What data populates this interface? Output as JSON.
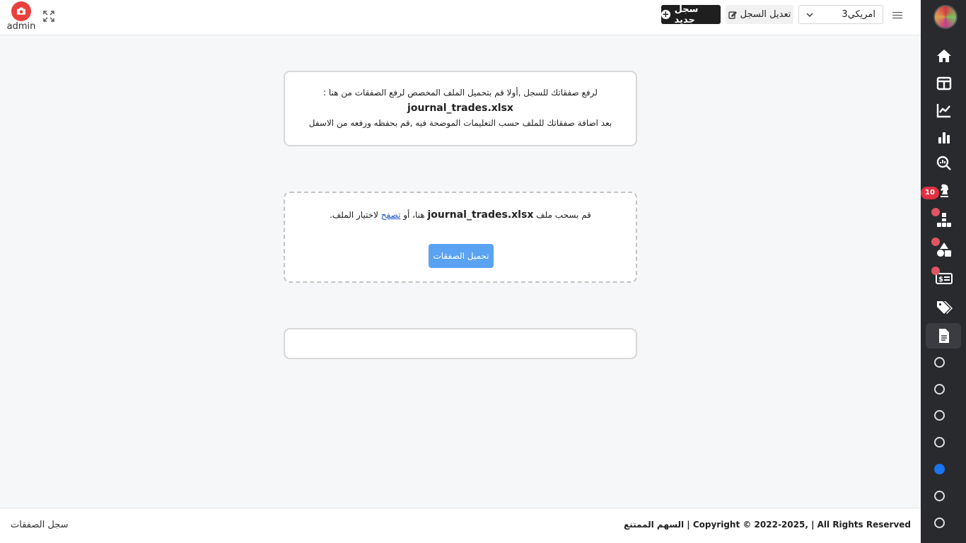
{
  "header": {
    "user_label": "admin",
    "new_button_label": "سجل جديد",
    "edit_button_label": "تعديل السجل",
    "account_select_value": "امريكي3"
  },
  "sidebar": {
    "notification_badge": "10",
    "icons": [
      "home-icon",
      "layout-icon",
      "line-chart-icon",
      "bar-chart-icon",
      "search-analytics-icon",
      "chess-knight-icon",
      "sitemap-icon",
      "shapes-icon",
      "money-card-icon",
      "tags-icon",
      "document-icon"
    ],
    "active_circle_color": "#1976f0"
  },
  "main": {
    "info": {
      "line1": "لرفع صفقاتك للسجل ,أولا قم بتحميل الملف المخصص لرفع الصفقات من هنا :",
      "filename": "journal_trades.xlsx",
      "line3": "بعد اضافة صفقاتك للملف حسب التعليمات الموضحة فيه ,قم بحفظه ورفعه من الاسفل"
    },
    "dropzone": {
      "text_before": "قم بسحب ملف",
      "filename": "journal_trades.xlsx",
      "text_middle": "هنا، أو",
      "browse_link": "تصفح",
      "text_after": "لاختيار الملف.",
      "upload_button_label": "تحميل الصفقات"
    }
  },
  "footer": {
    "left_text": "سجل الصفقات",
    "copyright": "السهم الممتنع | Copyright © 2022-2025, | All Rights Reserved"
  }
}
